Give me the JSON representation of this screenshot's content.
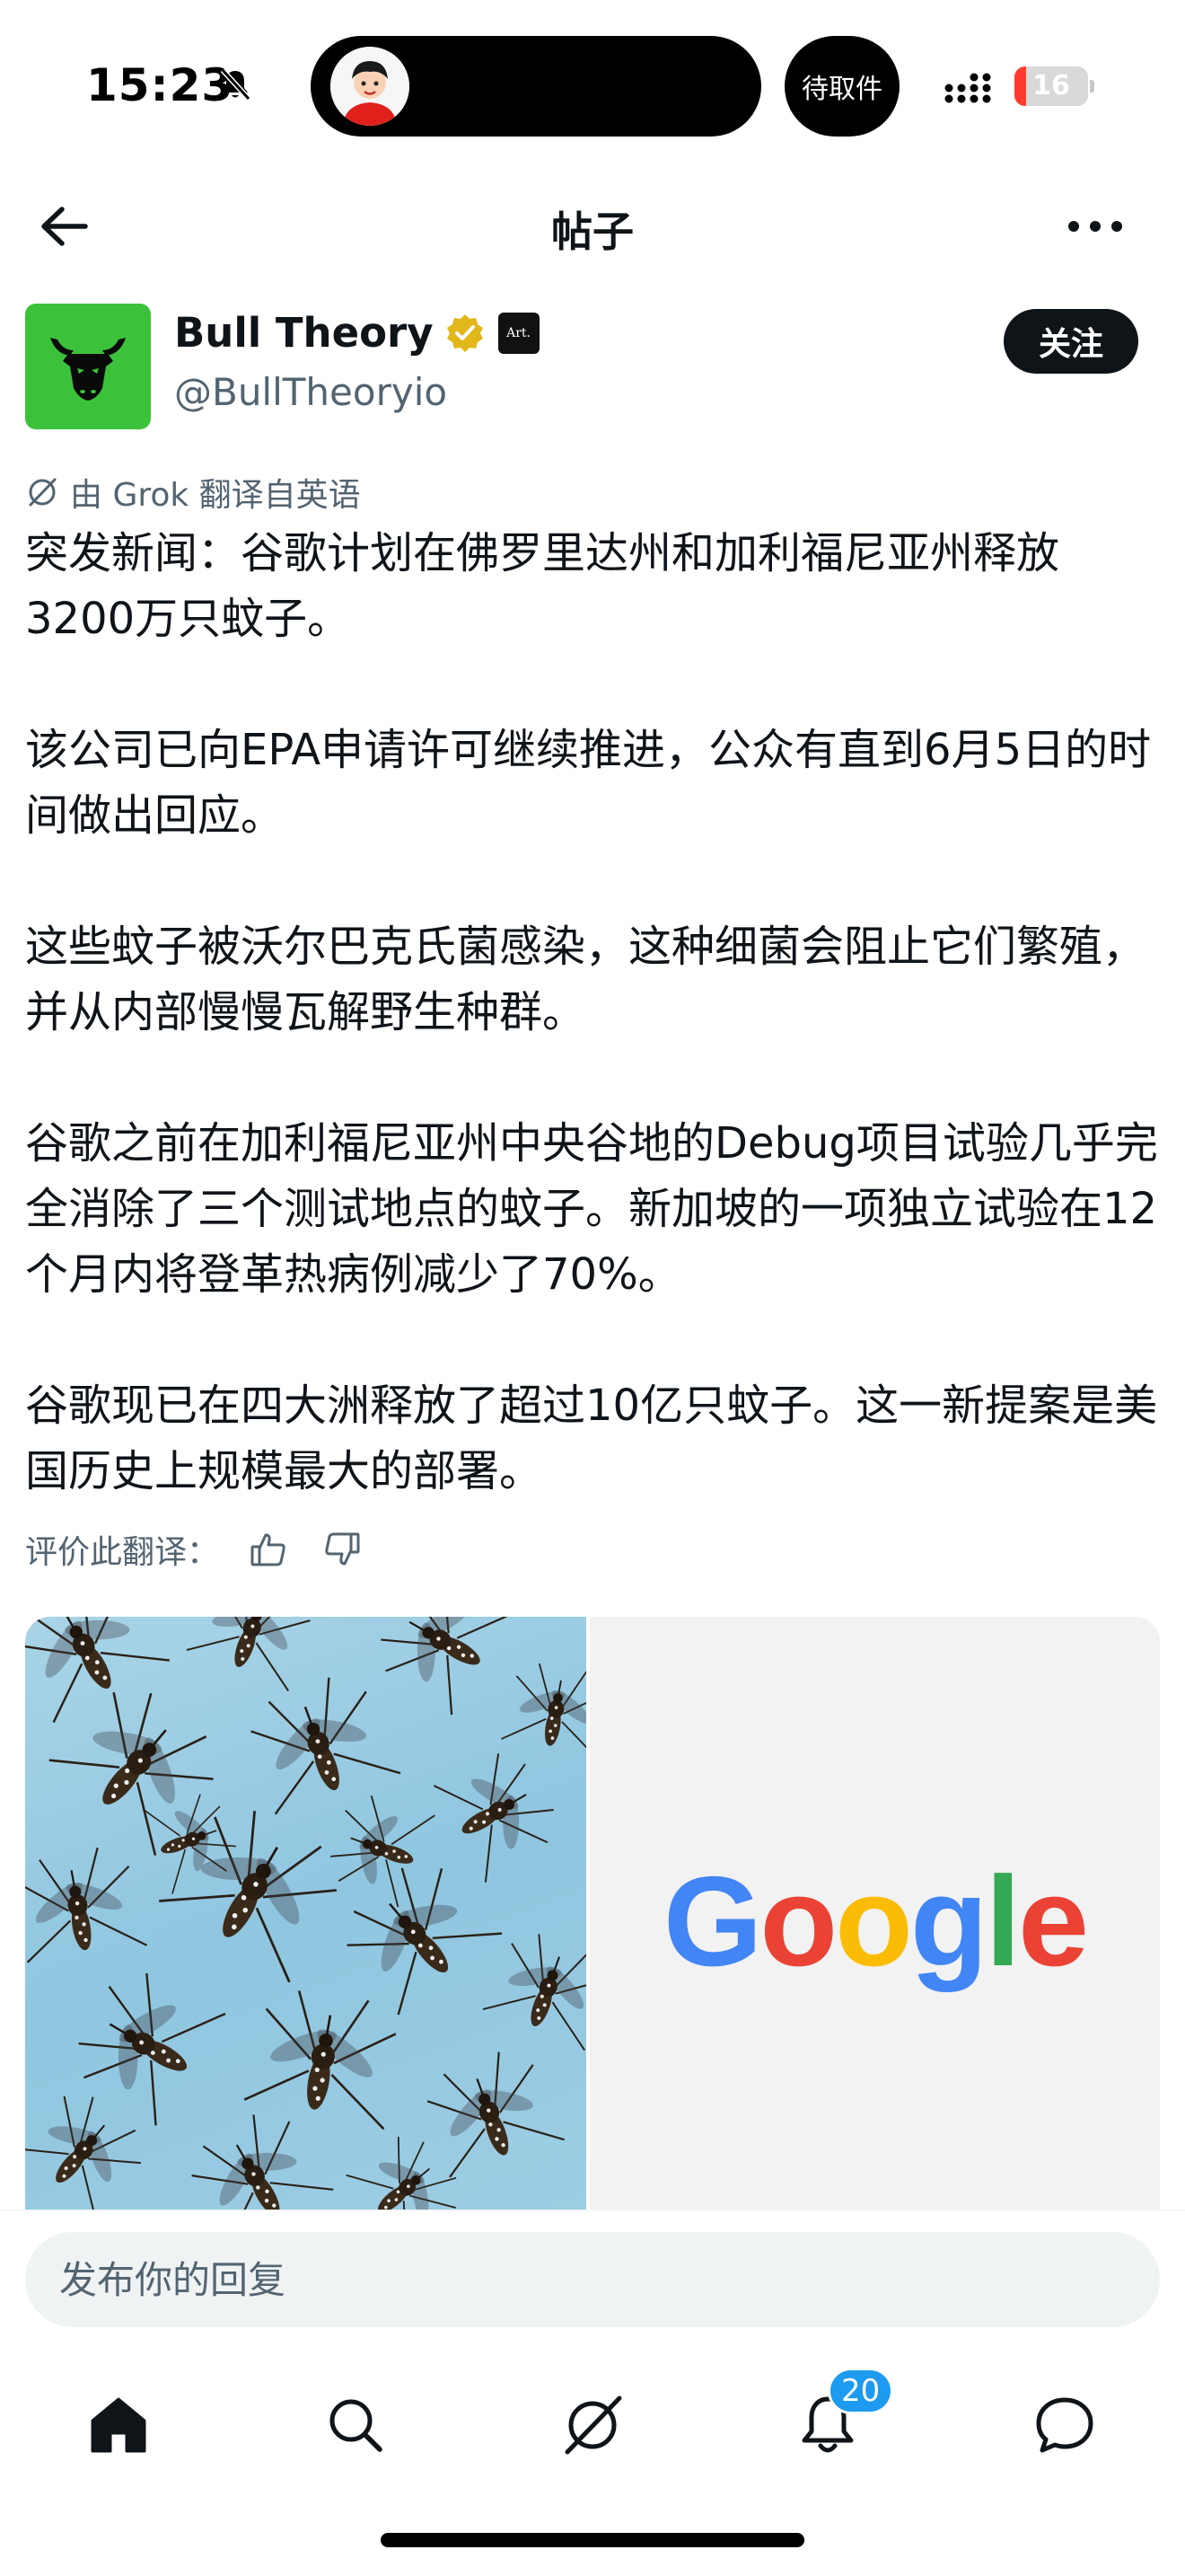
{
  "status_bar": {
    "time": "15:23",
    "pickup_label": "待取件",
    "battery_level": "16",
    "battery_fraction": 0.16,
    "battery_color": "#ff3b30"
  },
  "nav": {
    "title": "帖子"
  },
  "author": {
    "name": "Bull Theory",
    "handle": "@BullTheoryio",
    "affiliate_badge_text": "Art.",
    "follow_label": "关注",
    "avatar_color": "#3cc23a"
  },
  "translation_note": "由 Grok 翻译自英语",
  "post": {
    "paragraphs": [
      "突发新闻：谷歌计划在佛罗里达州和加利福尼亚州释放3200万只蚊子。",
      "该公司已向EPA申请许可继续推进，公众有直到6月5日的时间做出回应。",
      "这些蚊子被沃尔巴克氏菌感染，这种细菌会阻止它们繁殖，并从内部慢慢瓦解野生种群。",
      "谷歌之前在加利福尼亚州中央谷地的Debug项目试验几乎完全消除了三个测试地点的蚊子。新加坡的一项独立试验在12个月内将登革热病例减少了70%。",
      "谷歌现已在四大洲释放了超过10亿只蚊子。这一新提案是美国历史上规模最大的部署。"
    ]
  },
  "rate_translation_label": "评价此翻译：",
  "media": {
    "google_letters": [
      {
        "char": "G",
        "color": "#4285f4"
      },
      {
        "char": "o",
        "color": "#ea4335"
      },
      {
        "char": "o",
        "color": "#fbbc05"
      },
      {
        "char": "g",
        "color": "#4285f4"
      },
      {
        "char": "l",
        "color": "#34a853"
      },
      {
        "char": "e",
        "color": "#ea4335"
      }
    ]
  },
  "reply": {
    "placeholder": "发布你的回复"
  },
  "tabs": {
    "notifications_badge": "20",
    "accent_color": "#1d9bf0"
  }
}
